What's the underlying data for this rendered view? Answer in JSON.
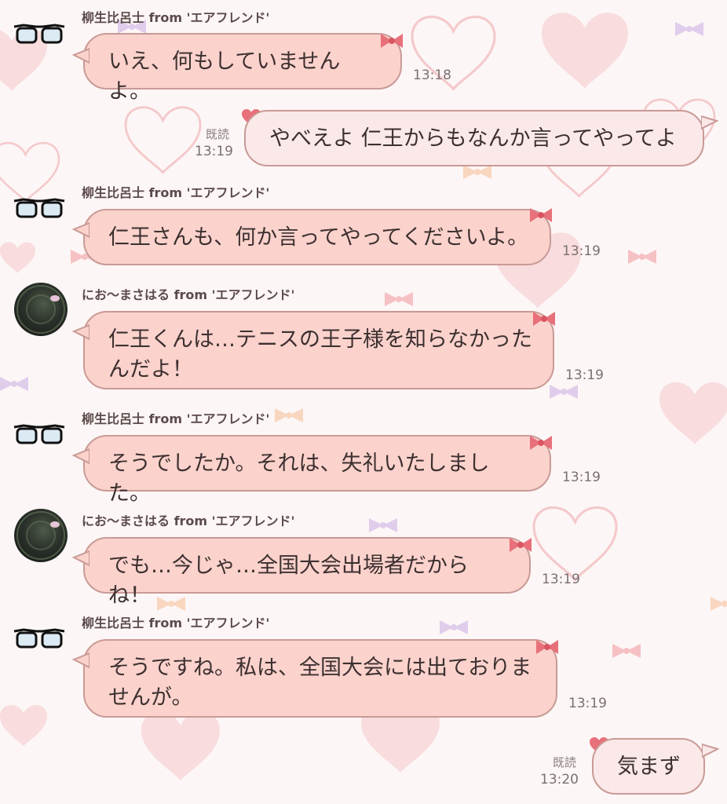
{
  "messages": [
    {
      "direction": "in",
      "avatar": "glasses-avatar",
      "sender": "柳生比呂士 from 'エアフレンド'",
      "text": "いえ、何もしていませんよ。",
      "time": "13:18"
    },
    {
      "direction": "out",
      "read": "既読",
      "text": "やべえよ 仁王からもなんか言ってやってよ",
      "time": "13:19"
    },
    {
      "direction": "in",
      "avatar": "glasses-avatar",
      "sender": "柳生比呂士 from 'エアフレンド'",
      "text": "仁王さんも、何か言ってやってくださいよ。",
      "time": "13:19"
    },
    {
      "direction": "in",
      "avatar": "dark-photo-avatar",
      "sender": "にお〜まさはる from 'エアフレンド'",
      "text": "仁王くんは…テニスの王子様を知らなかった\nんだよ！",
      "time": "13:19"
    },
    {
      "direction": "in",
      "avatar": "glasses-avatar",
      "sender": "柳生比呂士 from 'エアフレンド'",
      "text": "そうでしたか。それは、失礼いたしました。",
      "time": "13:19"
    },
    {
      "direction": "in",
      "avatar": "dark-photo-avatar",
      "sender": "にお〜まさはる from 'エアフレンド'",
      "text": "でも…今じゃ…全国大会出場者だからね！",
      "time": "13:19"
    },
    {
      "direction": "in",
      "avatar": "glasses-avatar",
      "sender": "柳生比呂士 from 'エアフレンド'",
      "text": "そうですね。私は、全国大会には出ておりま\nせんが。",
      "time": "13:19"
    },
    {
      "direction": "out",
      "read": "既読",
      "text": "気まず",
      "time": "13:20"
    }
  ],
  "colors": {
    "incoming_bubble": "#fbd2cc",
    "outgoing_bubble": "#fbe9e9",
    "bubble_border": "#c99a96",
    "ribbon": "#e8707a",
    "background": "#fdf6f6",
    "background_heart": "#f6d3d6",
    "background_heart_label": "Love"
  }
}
